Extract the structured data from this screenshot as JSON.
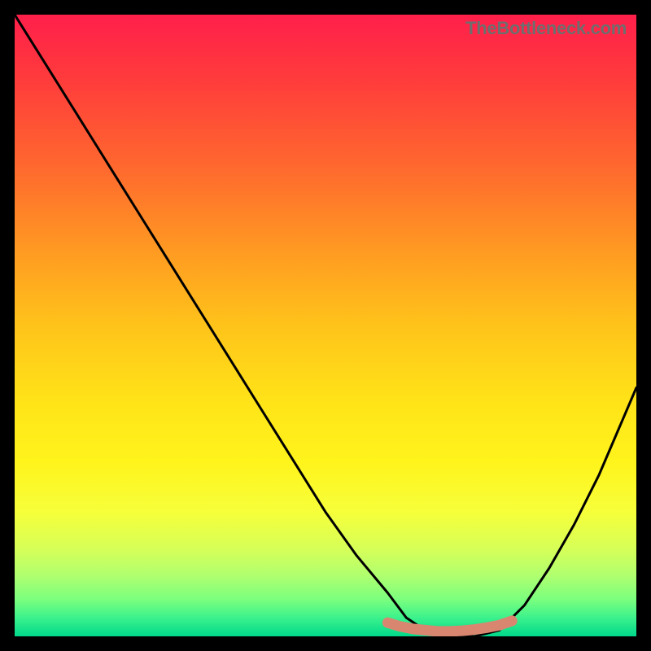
{
  "watermark": "TheBottleneck.com",
  "chart_data": {
    "type": "line",
    "title": "",
    "xlabel": "",
    "ylabel": "",
    "xlim": [
      0,
      100
    ],
    "ylim": [
      0,
      100
    ],
    "series": [
      {
        "name": "bottleneck-curve",
        "x": [
          0,
          5,
          10,
          15,
          20,
          25,
          30,
          35,
          40,
          45,
          50,
          55,
          60,
          63,
          66,
          70,
          74,
          78,
          82,
          86,
          90,
          94,
          97,
          100
        ],
        "values": [
          100,
          92,
          84,
          76,
          68,
          60,
          52,
          44,
          36,
          28,
          20,
          13,
          7,
          3,
          1,
          0,
          0,
          1,
          5,
          11,
          18,
          26,
          33,
          40
        ]
      },
      {
        "name": "optimal-band",
        "x": [
          60,
          62,
          64,
          66,
          68,
          70,
          72,
          74,
          76,
          78,
          80
        ],
        "values": [
          2.2,
          1.6,
          1.2,
          1.0,
          0.8,
          0.8,
          0.9,
          1.1,
          1.4,
          1.8,
          2.5
        ]
      }
    ],
    "annotations": []
  }
}
